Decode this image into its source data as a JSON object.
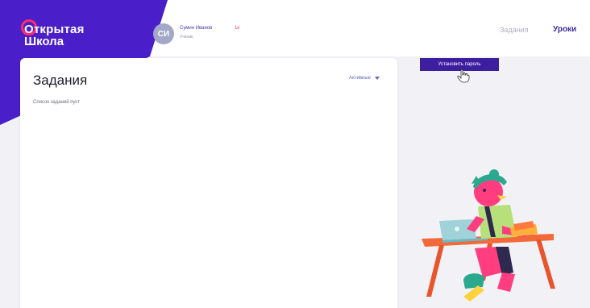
{
  "header": {
    "logo_line1": "Открытая",
    "logo_line2": "Школа",
    "user_initials": "СИ",
    "user_name": "Сумин Иванов",
    "user_grade": "1к",
    "user_role": "Ученик",
    "nav": {
      "tasks": "Задания",
      "lessons": "Уроки"
    }
  },
  "main": {
    "title": "Задания",
    "filter_label": "Активные",
    "empty_text": "Список заданий пуст"
  },
  "side": {
    "set_password_button": "Установить пароль"
  },
  "colors": {
    "brand": "#4a1fc9",
    "brand_dark": "#3b1f9e",
    "accent": "#ff2c6d"
  },
  "icons": [
    "logo-ring-icon",
    "caret-down-icon",
    "hand-cursor-icon"
  ]
}
